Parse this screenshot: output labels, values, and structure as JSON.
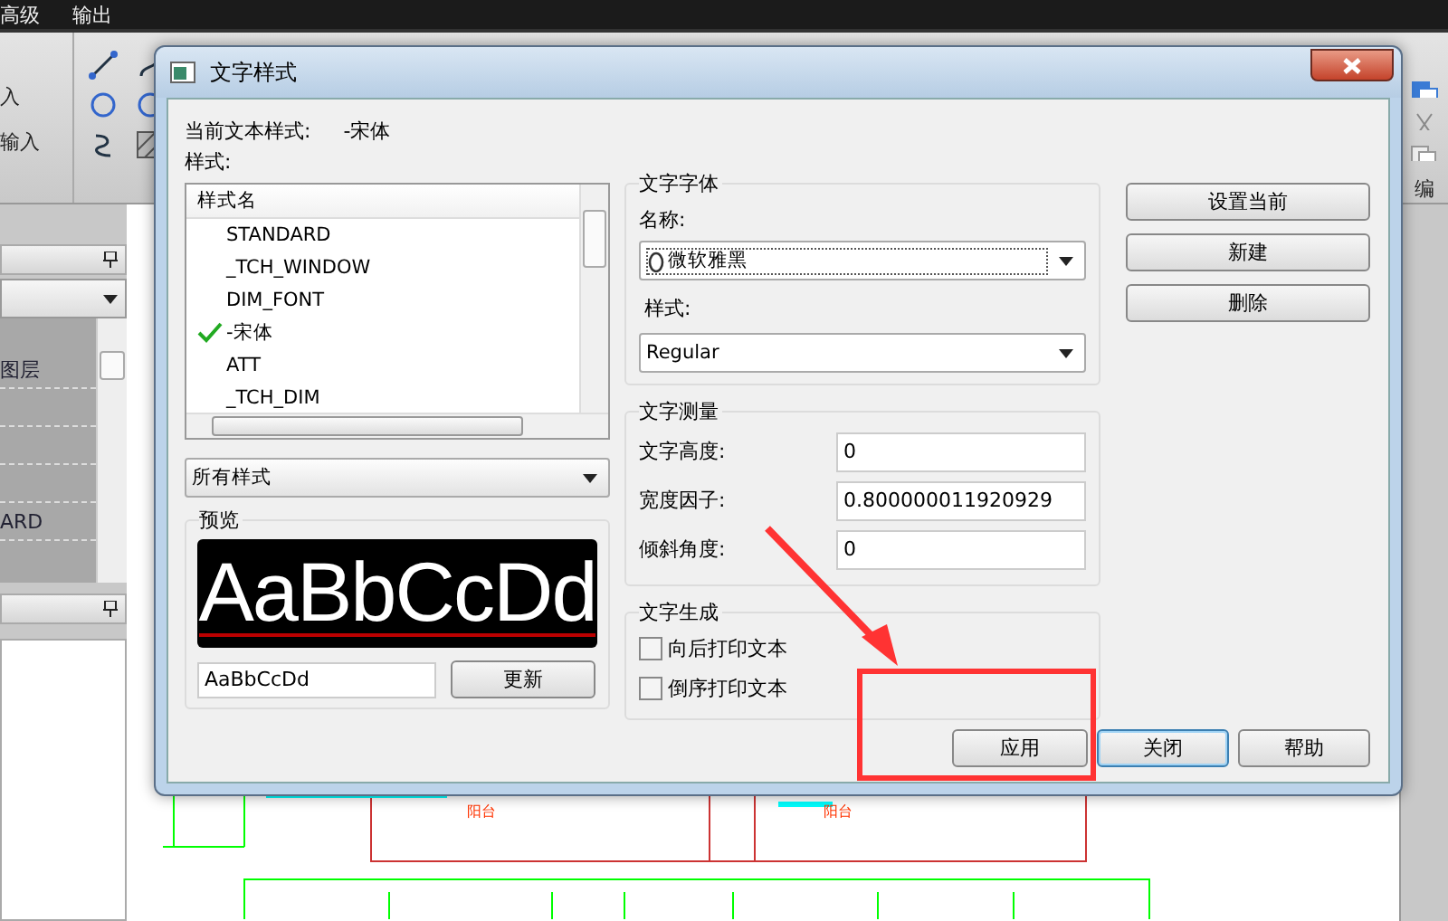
{
  "menu_bar": {
    "items": [
      "高级",
      "输出"
    ]
  },
  "ribbon": {
    "labels": [
      "入",
      "输入"
    ],
    "right_label": "编"
  },
  "layer_panel": {
    "items": [
      "图层",
      "ARD"
    ]
  },
  "drawing": {
    "labels": [
      "阳台",
      "阳台"
    ]
  },
  "dialog": {
    "title": "文字样式",
    "current_style_label": "当前文本样式:",
    "current_style_value": "-宋体",
    "styles_label": "样式:",
    "list": {
      "header": "样式名",
      "items": [
        {
          "name": "STANDARD",
          "current": false
        },
        {
          "name": "_TCH_WINDOW",
          "current": false
        },
        {
          "name": "DIM_FONT",
          "current": false
        },
        {
          "name": "-宋体",
          "current": true
        },
        {
          "name": "ATT",
          "current": false
        },
        {
          "name": "_TCH_DIM",
          "current": false
        }
      ]
    },
    "filter": "所有样式",
    "preview": {
      "label": "预览",
      "sample": "AaBbCcDd",
      "input": "AaBbCcDd",
      "button": "更新"
    },
    "font_group": {
      "title": "文字字体",
      "name_label": "名称:",
      "name_value": "微软雅黑",
      "style_label": "样式:",
      "style_value": "Regular"
    },
    "metrics_group": {
      "title": "文字测量",
      "fields": [
        {
          "label": "文字高度:",
          "value": "0"
        },
        {
          "label": "宽度因子:",
          "value": "0.800000011920929"
        },
        {
          "label": "倾斜角度:",
          "value": "0"
        }
      ]
    },
    "generation_group": {
      "title": "文字生成",
      "options": [
        {
          "label": "向后打印文本",
          "checked": false
        },
        {
          "label": "倒序打印文本",
          "checked": false
        }
      ]
    },
    "side_buttons": [
      "设置当前",
      "新建",
      "删除"
    ],
    "bottom_buttons": [
      {
        "label": "应用",
        "focused": false
      },
      {
        "label": "关闭",
        "focused": true
      },
      {
        "label": "帮助",
        "focused": false
      }
    ]
  }
}
